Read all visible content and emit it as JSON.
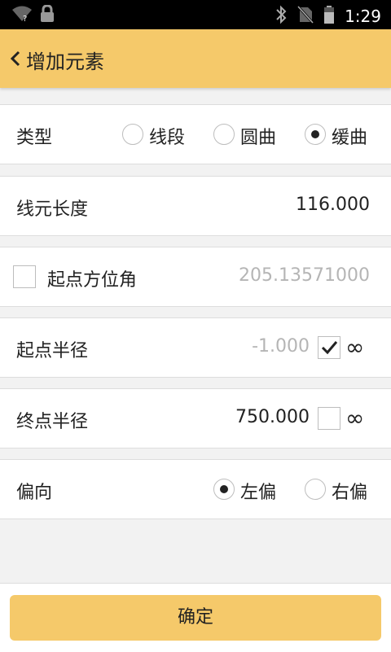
{
  "status_bar": {
    "time": "1:29"
  },
  "app_bar": {
    "title": "增加元素"
  },
  "form": {
    "type": {
      "label": "类型",
      "options": [
        "线段",
        "圆曲",
        "缓曲"
      ],
      "selected": "缓曲"
    },
    "length": {
      "label": "线元长度",
      "value": "116.000"
    },
    "start_azimuth": {
      "label": "起点方位角",
      "value": "205.13571000",
      "checked": false
    },
    "start_radius": {
      "label": "起点半径",
      "value": "-1.000",
      "infinity_checked": true,
      "infinity_symbol": "∞"
    },
    "end_radius": {
      "label": "终点半径",
      "value": "750.000",
      "infinity_checked": false,
      "infinity_symbol": "∞"
    },
    "deflection": {
      "label": "偏向",
      "options": [
        "左偏",
        "右偏"
      ],
      "selected": "左偏"
    }
  },
  "confirm_button": {
    "label": "确定"
  },
  "colors": {
    "accent": "#f5c96a",
    "status_bar": "#000000"
  },
  "icons": [
    "wifi-icon",
    "lock-icon",
    "bluetooth-icon",
    "no-sim-icon",
    "battery-icon",
    "back-chevron-icon",
    "check-icon"
  ]
}
